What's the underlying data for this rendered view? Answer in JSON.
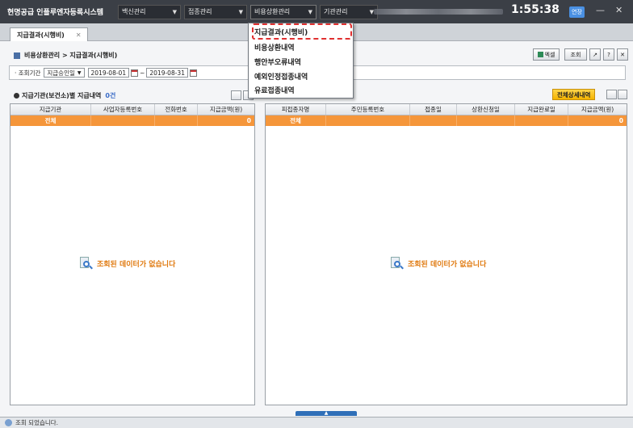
{
  "app": {
    "title": "현명공급 인플루엔자등록시스템",
    "clock": "1:55:38",
    "extend_label": "연장",
    "minimize": "—",
    "close": "✕"
  },
  "menus": [
    {
      "label": "백신관리"
    },
    {
      "label": "접종관리"
    },
    {
      "label": "비용상환관리"
    },
    {
      "label": "기관관리"
    }
  ],
  "tab": {
    "label": "지급결과(시행비)",
    "close": "✕"
  },
  "breadcrumb": "비용상환관리 > 지급결과(시행비)",
  "toolbar": {
    "excel": "엑셀",
    "search": "조회",
    "icon2": "↗",
    "help": "?",
    "close": "✕"
  },
  "filter": {
    "label": "· 조회기간",
    "type": "지급승인일",
    "date_from": "2019-08-01",
    "tilde": "~",
    "date_to": "2019-08-31"
  },
  "left_panel": {
    "title": "지급기관(보건소)별 지급내역",
    "count": "0건",
    "columns": [
      "지급기관",
      "사업자등록번호",
      "전화번호",
      "지급금액(원)"
    ],
    "summary": [
      "전체",
      "",
      "",
      "0"
    ],
    "empty": "조회된 데이터가 없습니다"
  },
  "right_panel": {
    "detail_button": "전체상세내역",
    "columns": [
      "피접종자명",
      "주민등록번호",
      "접종일",
      "상환신청일",
      "지급완료일",
      "지급금액(원)"
    ],
    "summary": [
      "전체",
      "",
      "",
      "",
      "",
      "0"
    ],
    "empty": "조회된 데이터가 없습니다"
  },
  "dropdown": {
    "items": [
      "지급결과(시행비)",
      "비용상환내역",
      "행안부오류내역",
      "예외인정접종내역",
      "유료접종내역"
    ],
    "selected_index": 0,
    "highlight_color": "#e03030"
  },
  "status": "조회 되었습니다.",
  "colors": {
    "summary_row": "#f5963a",
    "topbar": "#3b3f46",
    "empty_text": "#e07a10"
  }
}
